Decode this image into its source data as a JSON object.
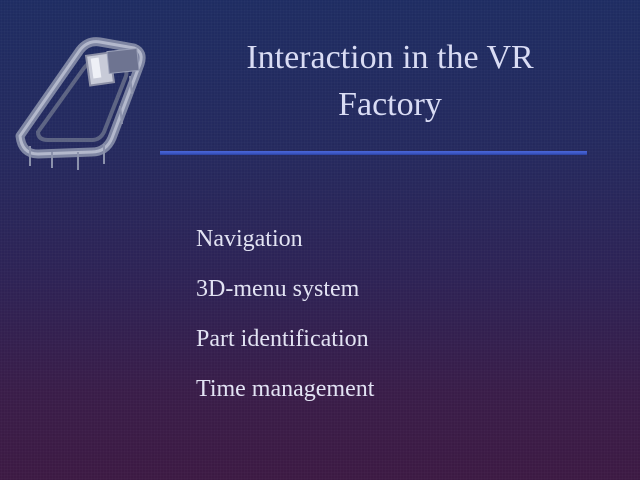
{
  "slide": {
    "title_line1": "Interaction in the VR",
    "title_line2": "Factory",
    "items": [
      "Navigation",
      "3D-menu system",
      "Part identification",
      "Time management"
    ]
  },
  "colors": {
    "background_top": "#1f2d63",
    "background_bottom": "#3d1a44",
    "rule": "#3b56c4",
    "text": "#e2e3f3"
  },
  "icons": {
    "logo": "conveyor-machine-icon"
  }
}
